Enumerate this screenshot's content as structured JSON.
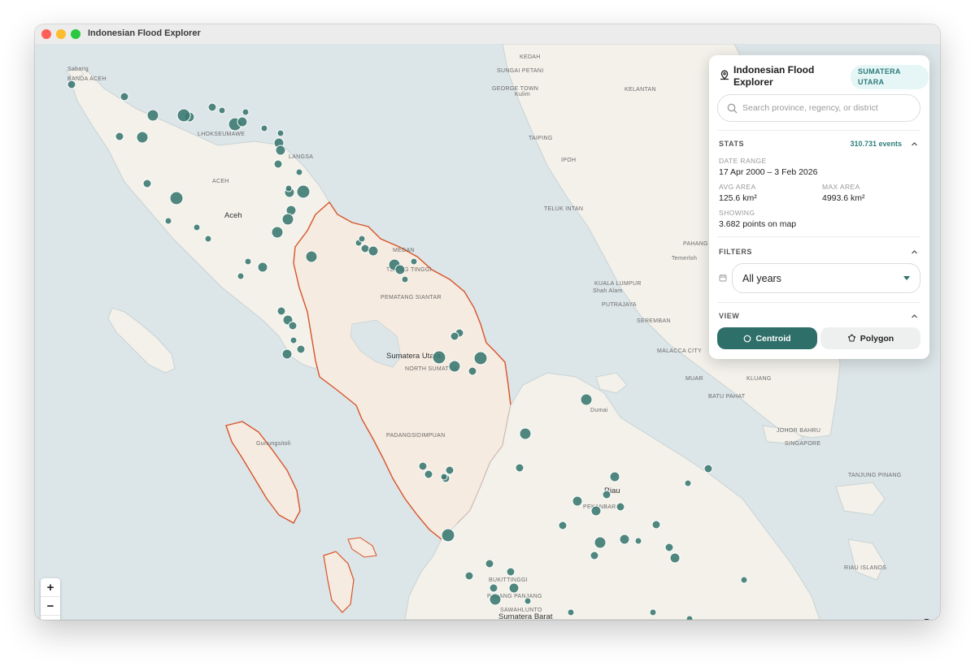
{
  "window": {
    "title": "Indonesian Flood Explorer"
  },
  "panel": {
    "title": "Indonesian Flood Explorer",
    "region_badge": "SUMATERA UTARA",
    "search_placeholder": "Search province, regency, or district",
    "stats": {
      "label": "STATS",
      "events": "310.731 events",
      "date_range_label": "DATE RANGE",
      "date_range_value": "17 Apr 2000 – 3 Feb 2026",
      "avg_area_label": "AVG AREA",
      "avg_area_value": "125.6 km²",
      "max_area_label": "MAX AREA",
      "max_area_value": "4993.6 km²",
      "showing_label": "SHOWING",
      "showing_value": "3.682 points on map"
    },
    "filters": {
      "label": "FILTERS",
      "year_value": "All years"
    },
    "view": {
      "label": "VIEW",
      "centroid_label": "Centroid",
      "polygon_label": "Polygon",
      "active": "Centroid"
    }
  },
  "map": {
    "labels": {
      "kedah": "KEDAH",
      "sungai_petani": "SUNGAI PETANI",
      "george_town": "GEORGE TOWN",
      "kulim": "Kulim",
      "kelantan": "KELANTAN",
      "taiping": "TAIPING",
      "ipoh": "IPOH",
      "teluk_intan": "TELUK INTAN",
      "pahang": "PAHANG",
      "temerloh": "Temerloh",
      "kuala_lumpur": "KUALA LUMPUR",
      "shah_alam": "Shah Alam",
      "putrajaya": "PUTRAJAYA",
      "seremban": "SEREMBAN",
      "malacca": "MALACCA CITY",
      "muar": "MUAR",
      "kluang": "KLUANG",
      "batu_pahat": "BATU PAHAT",
      "johor_bahru": "JOHOR BAHRU",
      "singapore": "SINGAPORE",
      "tanjung_pinang": "TANJUNG PINANG",
      "riau_islands": "RIAU ISLANDS",
      "banda_aceh": "BANDA ACEH",
      "sabang": "Sabang",
      "lhokseumawe": "LHOKSEUMAWE",
      "langsa": "LANGSA",
      "aceh_caps": "ACEH",
      "aceh": "Aceh",
      "tebing_tinggi": "TEBING TINGGI",
      "medan": "MEDAN",
      "pematang_siantar": "PEMATANG SIANTAR",
      "sumatera_utara": "Sumatera Utara",
      "north_sumatra": "NORTH SUMATRA",
      "padangsidimpuan": "PADANGSIDIMPUAN",
      "gunungsitoli": "Gunungsitoli",
      "dumai": "Dumai",
      "riau": "Riau",
      "pekanbaru": "PEKANBARU",
      "bukittinggi": "BUKITTINGGI",
      "padang_panjang": "PADANG PANJANG",
      "sawahlunto": "SAWAHLUNTO",
      "sumatera_barat": "Sumatera Barat"
    },
    "zoom_in": "+",
    "zoom_out": "−",
    "compass": "▲",
    "info": "i"
  },
  "colors": {
    "accent": "#2f6f69",
    "point": "#3d7a72",
    "highlight_border": "#d7542a"
  }
}
